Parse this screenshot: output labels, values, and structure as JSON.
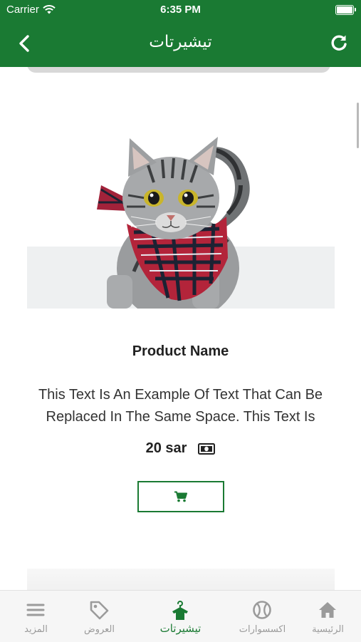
{
  "status_bar": {
    "carrier": "Carrier",
    "time": "6:35 PM"
  },
  "nav": {
    "title": "تيشيرتات",
    "back_icon": "chevron-left-icon",
    "refresh_icon": "refresh-icon"
  },
  "product": {
    "name": "Product Name",
    "description": "This Text Is An Example Of Text That Can Be Replaced In The Same Space. This Text Is",
    "price": "20 sar",
    "currency_icon": "money-icon",
    "cart_icon": "cart-icon"
  },
  "colors": {
    "brand": "#1a7a33",
    "inactive_tab": "#9b9b9b"
  },
  "tabs": [
    {
      "label": "المزيد",
      "icon": "menu-icon"
    },
    {
      "label": "العروض",
      "icon": "tag-icon"
    },
    {
      "label": "تيشيرتات",
      "icon": "shirt-hanger-icon",
      "active": true
    },
    {
      "label": "اكسسوارات",
      "icon": "ball-icon"
    },
    {
      "label": "الرئيسية",
      "icon": "home-icon"
    }
  ]
}
